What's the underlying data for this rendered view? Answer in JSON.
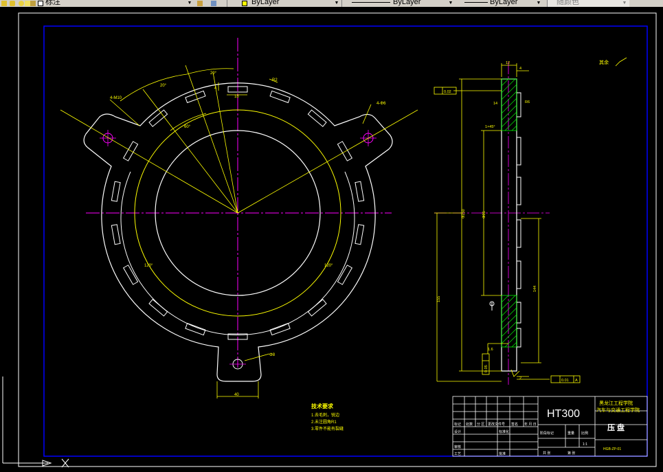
{
  "toolbar": {
    "text_style": "标注",
    "layer": "ByLayer",
    "linetype": "ByLayer",
    "lineweight": "ByLayer",
    "plotstyle": "随颜色"
  },
  "drawing": {
    "dims": {
      "angle_left_top": "20°",
      "angle_top": "20°",
      "angle_mid": "60°",
      "slot_width": "18",
      "slot_depth": "4",
      "r_top_right": "R2",
      "hole_left": "4-M10",
      "hole_right": "4-Φ6",
      "angle_bottom_left": "120°",
      "angle_bottom_right": "120°",
      "dia_bottom": "Φ8",
      "width_bottom": "40",
      "side_top_width": "12",
      "side_top_small": "4",
      "side_flatness": "0.02",
      "side_thickness": "14",
      "side_radius": "R6",
      "side_chamfer": "1×45°",
      "side_dia_big": "Φ250",
      "side_dia_mid": "Φ95",
      "side_height_left": "155",
      "side_height_right": "144",
      "side_bottom_small": "2",
      "side_bottom_tol": "0.05",
      "side_roughness_box": "1.6",
      "side_perp": "0.01",
      "datum": "A",
      "rest_roughness": "其余"
    },
    "notes": {
      "title": "技术要求",
      "items": [
        "1.去毛刺，锐边",
        "2.未注圆角R1",
        "3.零件不能有裂缝"
      ]
    },
    "titleblock": {
      "material": "HT300",
      "school1": "黑龙江工程学院",
      "school2": "汽车与交通工程学院",
      "part_name": "压 盘",
      "h_mark": "标记",
      "h_count": "处数",
      "h_zone": "分 区",
      "h_doc": "更改文件号",
      "h_sign": "签名",
      "h_date": "年 月 日",
      "h_design": "设计",
      "h_std": "标准化",
      "h_stage": "阶段标记",
      "h_weight": "重量",
      "h_scale": "比例",
      "scale": "1:1",
      "h_review": "审核",
      "h_craft": "工艺",
      "h_approve": "批准",
      "h_total": "共 张",
      "h_sheet": "第 张",
      "drawing_no": "HGB-ZP-01"
    }
  }
}
